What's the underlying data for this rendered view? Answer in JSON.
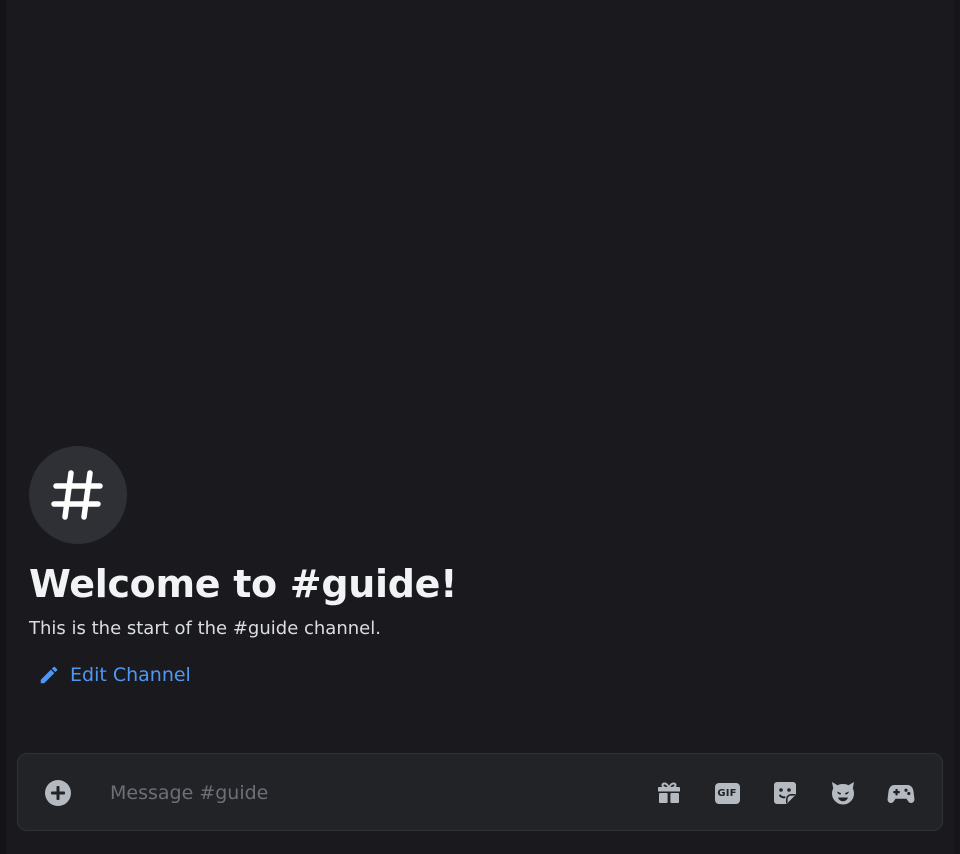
{
  "channel": {
    "name": "guide",
    "avatar_icon": "hash-icon",
    "welcome_title": "Welcome to #guide!",
    "welcome_subtitle": "This is the start of the #guide channel.",
    "edit_label": "Edit Channel"
  },
  "composer": {
    "placeholder": "Message #guide",
    "value": "",
    "buttons": [
      {
        "name": "upload",
        "icon": "plus-circle-icon"
      },
      {
        "name": "gift",
        "icon": "gift-icon"
      },
      {
        "name": "gif",
        "label": "GIF"
      },
      {
        "name": "sticker",
        "icon": "sticker-icon"
      },
      {
        "name": "emoji",
        "icon": "emoji-icon"
      },
      {
        "name": "apps",
        "icon": "gamepad-icon"
      }
    ]
  },
  "colors": {
    "background": "#1a1a1e",
    "link": "#4e97f5",
    "composer": "#222327",
    "icon": "#b5bac1"
  }
}
